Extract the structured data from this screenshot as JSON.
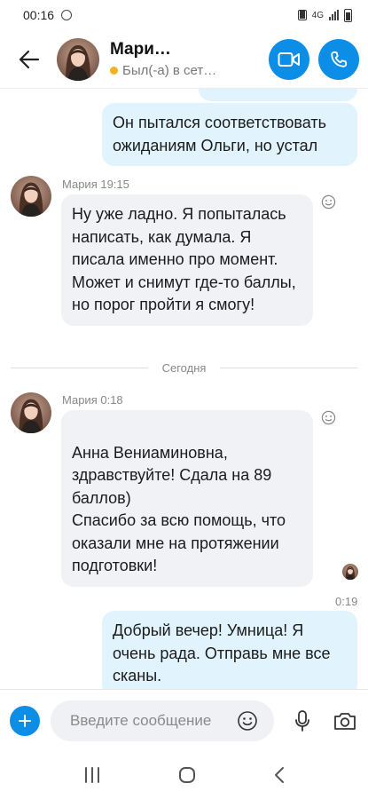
{
  "status_bar": {
    "time": "00:16",
    "network": "4G"
  },
  "header": {
    "name": "Мари…",
    "status": "Был(-а) в сет…"
  },
  "messages": [
    {
      "text": "Он пытался соответствовать ожиданиям Ольги, но устал"
    },
    {
      "sender": "Мария 19:15",
      "text": "Ну уже ладно. Я попыталась написать, как думала. Я писала именно про момент. Может и снимут где-то баллы, но порог пройти я смогу!"
    },
    {
      "sender": "Мария 0:18",
      "text": "Анна Вениаминовна, здравствуйте! Сдала на 89 баллов)\nСпасибо за всю помощь, что оказали мне на протяжении подготовки!"
    },
    {
      "time": "0:19",
      "text": "Добрый вечер! Умница! Я очень рада. Отправь мне все сканы."
    }
  ],
  "divider": {
    "label": "Сегодня"
  },
  "composer": {
    "placeholder": "Введите сообщение"
  },
  "colors": {
    "accent": "#0c8ee6",
    "outgoing_bubble": "#e1f3fc",
    "incoming_bubble": "#f1f2f5",
    "away_dot": "#f4b223"
  },
  "icons": [
    "back-arrow-icon",
    "video-camera-icon",
    "phone-icon",
    "add-reaction-icon",
    "plus-icon",
    "emoji-icon",
    "microphone-icon",
    "camera-icon",
    "recent-apps-icon",
    "home-icon",
    "nav-back-icon"
  ]
}
